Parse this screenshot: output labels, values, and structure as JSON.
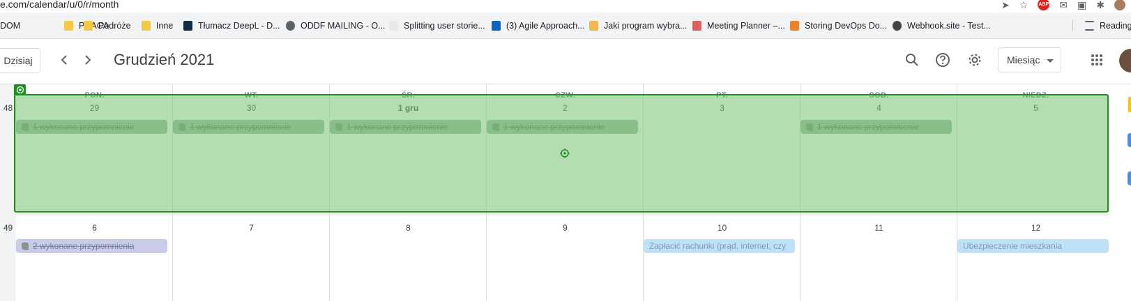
{
  "browser": {
    "url": "e.com/calendar/u/0/r/month",
    "abp_label": "ABP",
    "bookmarks": [
      {
        "label": "DOM",
        "icon": "none"
      },
      {
        "label": "PRACA",
        "icon": "folder-icon"
      },
      {
        "label": "Podróże",
        "icon": "folder-icon"
      },
      {
        "label": "Inne",
        "icon": "folder-icon"
      },
      {
        "label": "Tłumacz DeepL - D...",
        "icon": "deepl-icon"
      },
      {
        "label": "ODDF MAILING - O...",
        "icon": "globe-icon"
      },
      {
        "label": "Splitting user storie...",
        "icon": "page-icon"
      },
      {
        "label": "(3) Agile Approach...",
        "icon": "linkedin-icon"
      },
      {
        "label": "Jaki program wybra...",
        "icon": "handshake-icon"
      },
      {
        "label": "Meeting Planner –...",
        "icon": "dots-icon"
      },
      {
        "label": "Storing DevOps Do...",
        "icon": "stackoverflow-icon"
      },
      {
        "label": "Webhook.site - Test...",
        "icon": "webhook-icon"
      }
    ],
    "reading_list": "Reading"
  },
  "header": {
    "today_label": "Dzisiaj",
    "prev_icon": "chevron-left-icon",
    "next_icon": "chevron-right-icon",
    "title": "Grudzień 2021",
    "view_label": "Miesiąc"
  },
  "calendar": {
    "weekdays": [
      "PON.",
      "WT.",
      "ŚR.",
      "CZW.",
      "PT.",
      "SOB.",
      "NIEDZ."
    ],
    "weeks": [
      {
        "number": "48",
        "days": [
          {
            "label": "29",
            "bold": false
          },
          {
            "label": "30",
            "bold": false
          },
          {
            "label": "1 gru",
            "bold": true
          },
          {
            "label": "2",
            "bold": false
          },
          {
            "label": "3",
            "bold": false
          },
          {
            "label": "4",
            "bold": false
          },
          {
            "label": "5",
            "bold": false
          }
        ]
      },
      {
        "number": "49",
        "days": [
          {
            "label": "6",
            "bold": false
          },
          {
            "label": "7",
            "bold": false
          },
          {
            "label": "8",
            "bold": false
          },
          {
            "label": "9",
            "bold": false
          },
          {
            "label": "10",
            "bold": false
          },
          {
            "label": "11",
            "bold": false
          },
          {
            "label": "12",
            "bold": false
          }
        ]
      }
    ],
    "events": [
      {
        "week": 0,
        "day": 0,
        "text": "1 wykonane przypomnienie",
        "kind": "reminder"
      },
      {
        "week": 0,
        "day": 1,
        "text": "1 wykonane przypomnienie",
        "kind": "reminder"
      },
      {
        "week": 0,
        "day": 2,
        "text": "1 wykonane przypomnienie",
        "kind": "reminder"
      },
      {
        "week": 0,
        "day": 3,
        "text": "1 wykonane przypomnienie",
        "kind": "reminder"
      },
      {
        "week": 0,
        "day": 5,
        "text": "1 wykonane przypomnienie",
        "kind": "reminder"
      },
      {
        "week": 1,
        "day": 0,
        "text": "2 wykonane przypomnienia",
        "kind": "reminder2"
      },
      {
        "week": 1,
        "day": 4,
        "text": "Zapłacić rachunki (prąd, internet, czy",
        "kind": "task"
      },
      {
        "week": 1,
        "day": 6,
        "text": "Ubezpieczenie mieszkania",
        "kind": "task"
      }
    ]
  },
  "colors": {
    "selection_fill": "#7ec478",
    "selection_border": "#1e8e1e",
    "reminder_chip": "#97b7a3",
    "task_chip": "#bfe1f8"
  }
}
